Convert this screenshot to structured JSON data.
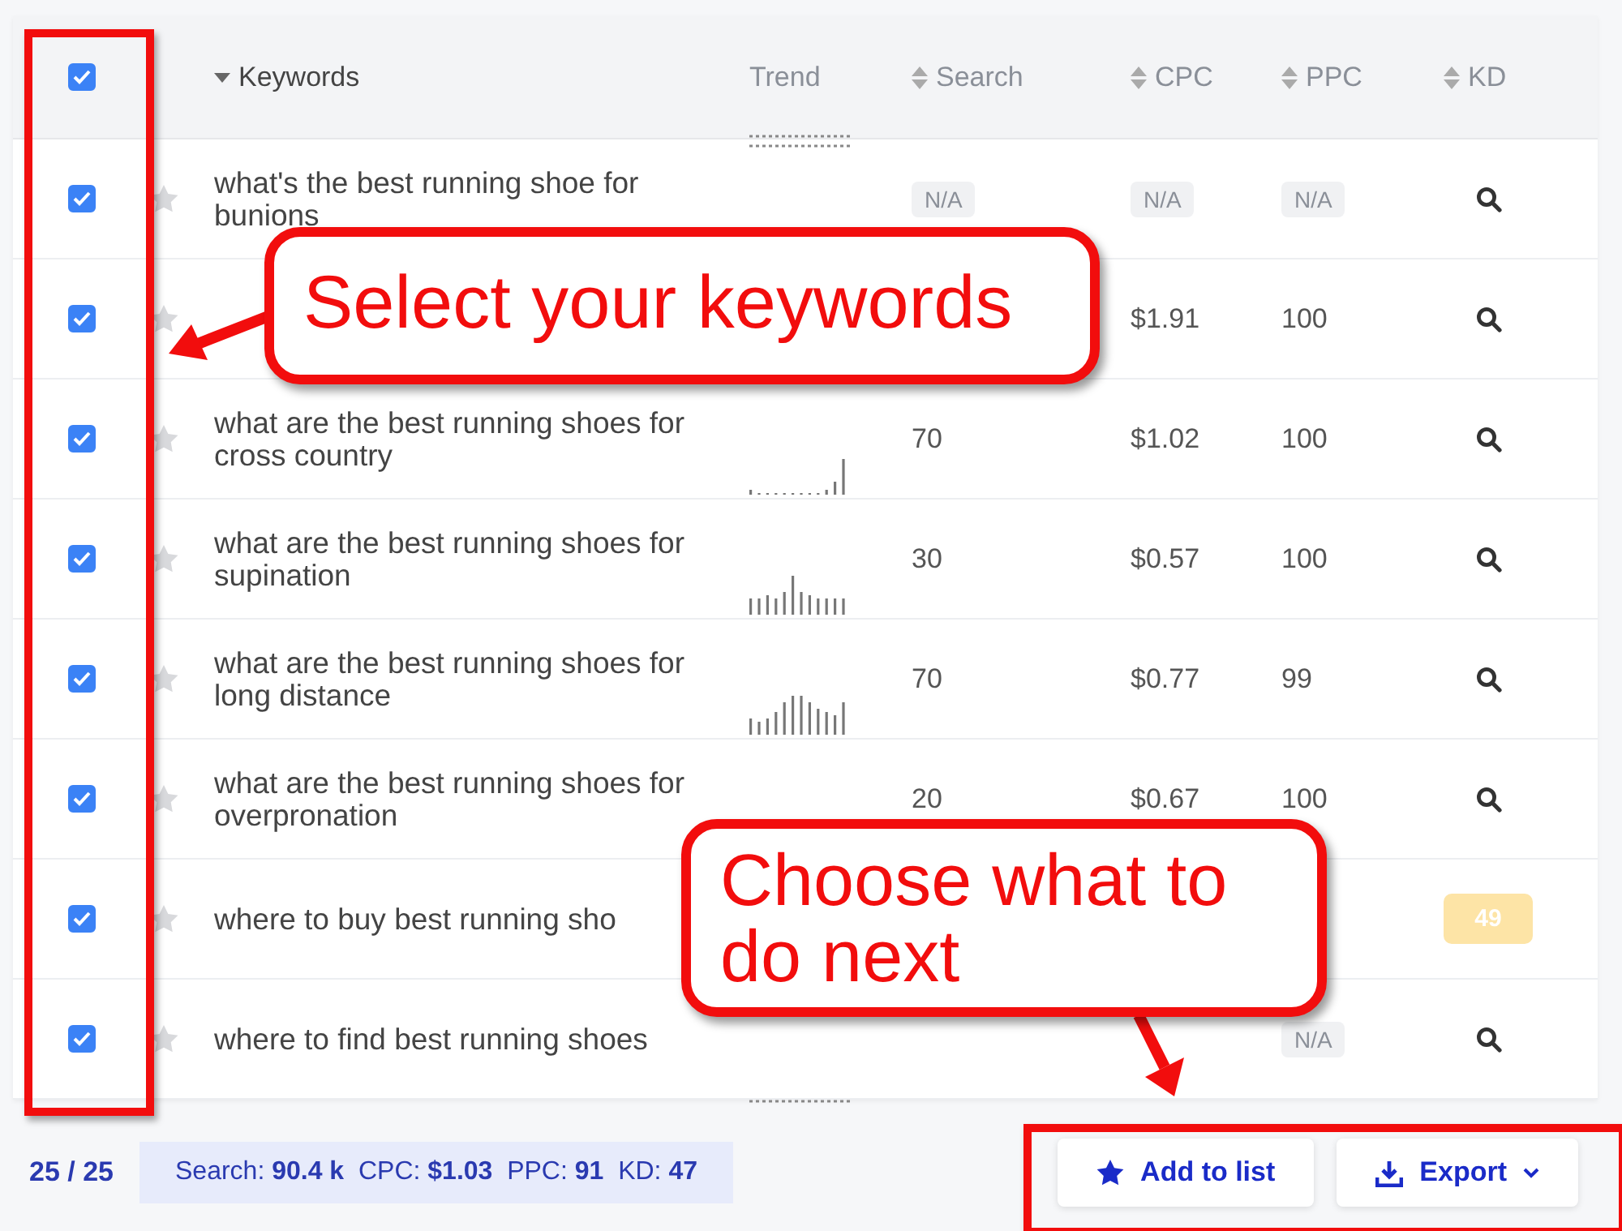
{
  "select_all": {
    "checked": true
  },
  "columns": [
    {
      "label": "Keywords",
      "kind": "desc"
    },
    {
      "label": "Trend",
      "kind": "plain"
    },
    {
      "label": "Search",
      "kind": "sortable"
    },
    {
      "label": "CPC",
      "kind": "sortable"
    },
    {
      "label": "PPC",
      "kind": "sortable"
    },
    {
      "label": "KD",
      "kind": "sortable"
    }
  ],
  "rows": [
    {
      "checked": true,
      "starred": false,
      "keyword": "what's the best running shoe for bunions",
      "trend": {
        "kind": "dots-top"
      },
      "search": {
        "kind": "na",
        "text": "N/A"
      },
      "cpc": {
        "kind": "na",
        "text": "N/A"
      },
      "ppc": {
        "kind": "na",
        "text": "N/A"
      },
      "kd": {
        "kind": "lookup"
      }
    },
    {
      "checked": true,
      "starred": false,
      "trend": {
        "kind": "none"
      },
      "search": {
        "kind": "none"
      },
      "cpc": {
        "kind": "plain",
        "text": "$1.91"
      },
      "ppc": {
        "kind": "plain",
        "text": "100"
      },
      "kd": {
        "kind": "lookup"
      }
    },
    {
      "checked": true,
      "starred": false,
      "keyword": "what are the best running shoes for cross country",
      "trend": {
        "kind": "rise"
      },
      "search": {
        "kind": "plain",
        "text": "70"
      },
      "cpc": {
        "kind": "plain",
        "text": "$1.02"
      },
      "ppc": {
        "kind": "plain",
        "text": "100"
      },
      "kd": {
        "kind": "lookup"
      }
    },
    {
      "checked": true,
      "starred": false,
      "keyword": "what are the best running shoes for supination",
      "trend": {
        "kind": "wave"
      },
      "search": {
        "kind": "plain",
        "text": "30"
      },
      "cpc": {
        "kind": "plain",
        "text": "$0.57"
      },
      "ppc": {
        "kind": "plain",
        "text": "100"
      },
      "kd": {
        "kind": "lookup"
      }
    },
    {
      "checked": true,
      "starred": false,
      "keyword": "what are the best running shoes for long distance",
      "trend": {
        "kind": "hump"
      },
      "search": {
        "kind": "plain",
        "text": "70"
      },
      "cpc": {
        "kind": "plain",
        "text": "$0.77"
      },
      "ppc": {
        "kind": "plain",
        "text": "99"
      },
      "kd": {
        "kind": "lookup"
      }
    },
    {
      "checked": true,
      "starred": false,
      "keyword": "what are the best running shoes for overpronation",
      "trend": {
        "kind": "none"
      },
      "search": {
        "kind": "plain",
        "text": "20"
      },
      "cpc": {
        "kind": "plain",
        "text": "$0.67"
      },
      "ppc": {
        "kind": "plain",
        "text": "100"
      },
      "kd": {
        "kind": "lookup"
      }
    },
    {
      "checked": true,
      "starred": false,
      "keyword": "where to buy best running sho",
      "trend": {
        "kind": "none"
      },
      "search": {
        "kind": "none"
      },
      "cpc": {
        "kind": "none"
      },
      "ppc": {
        "kind": "none"
      },
      "kd": {
        "kind": "badge",
        "text": "49"
      }
    },
    {
      "checked": true,
      "starred": false,
      "keyword": "where to find best running shoes",
      "trend": {
        "kind": "dots-bottom"
      },
      "search": {
        "kind": "none"
      },
      "cpc": {
        "kind": "none"
      },
      "ppc": {
        "kind": "na",
        "text": "N/A"
      },
      "kd": {
        "kind": "lookup"
      }
    }
  ],
  "footer": {
    "count": "25 / 25",
    "summary": "Search: **90.4 k**  CPC: **$1.03**  PPC: **91**  KD: **47**"
  },
  "buttons": [
    {
      "label": "Add to list"
    },
    {
      "label": "Export"
    }
  ],
  "callouts": [
    {
      "text": "Select your keywords"
    },
    {
      "text": "Choose what to do next"
    }
  ]
}
